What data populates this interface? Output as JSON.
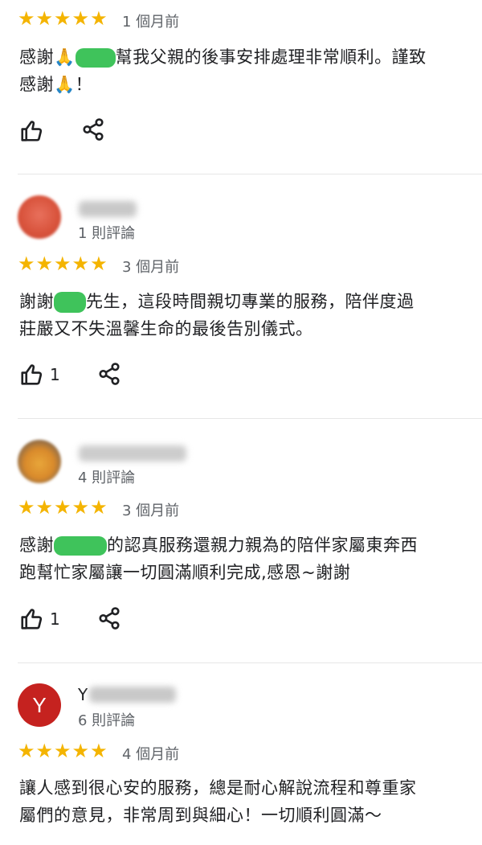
{
  "colors": {
    "star": "#f4b400",
    "redact": "#3fc35b",
    "avatar_y": "#c5221f"
  },
  "reviews": [
    {
      "time": "1 個月前",
      "text_lines": [
        {
          "pre": "感謝🙏",
          "post": "幫我父親的後事安排處理非常順利。謹致"
        },
        {
          "pre": "感謝🙏！",
          "post": ""
        }
      ],
      "likes": ""
    },
    {
      "review_count": "1 則評論",
      "time": "3 個月前",
      "text_lines": [
        {
          "pre": "謝謝",
          "post": "先生，這段時間親切專業的服務，陪伴度過"
        },
        {
          "pre": "莊嚴又不失溫馨生命的最後告別儀式。",
          "post": ""
        }
      ],
      "likes": "1"
    },
    {
      "review_count": "4 則評論",
      "time": "3 個月前",
      "text_lines": [
        {
          "pre": "感謝",
          "post": "的認真服務還親力親為的陪伴家屬東奔西"
        },
        {
          "pre": "跑幫忙家屬讓一切圓滿順利完成,感恩~謝謝",
          "post": ""
        }
      ],
      "likes": "1"
    },
    {
      "avatar_letter": "Y",
      "name_initial": "Y",
      "review_count": "6 則評論",
      "time": "4 個月前",
      "text_lines": [
        {
          "pre": "讓人感到很心安的服務，總是耐心解說流程和尊重家",
          "post": ""
        },
        {
          "pre": "屬們的意見，非常周到與細心！一切順利圓滿～",
          "post": ""
        }
      ]
    }
  ]
}
